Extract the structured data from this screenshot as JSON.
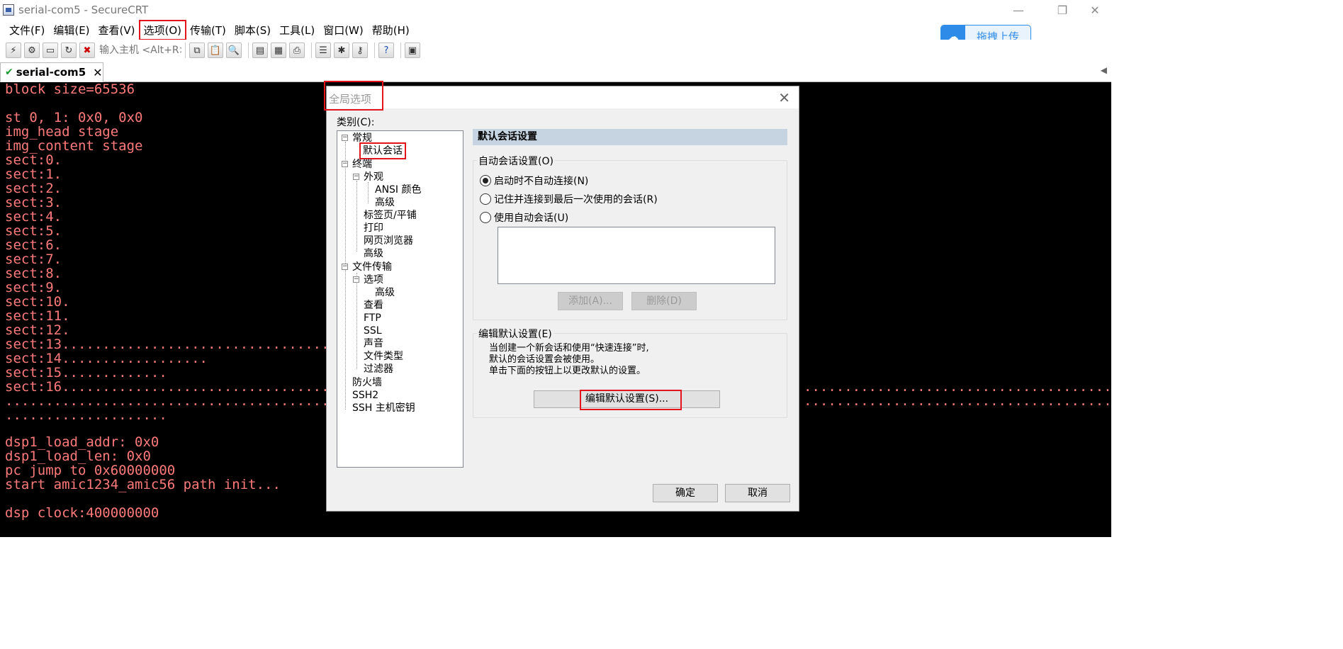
{
  "window": {
    "title": "serial-com5 - SecureCRT",
    "minimize": "—",
    "restore": "❐",
    "close": "✕"
  },
  "menu": [
    "文件(F)",
    "编辑(E)",
    "查看(V)",
    "选项(O)",
    "传输(T)",
    "脚本(S)",
    "工具(L)",
    "窗口(W)",
    "帮助(H)"
  ],
  "upload": {
    "label": "拖拽上传"
  },
  "toolbar": {
    "host_placeholder": "输入主机 <Alt+R>"
  },
  "tab": {
    "label": "serial-com5",
    "close": "✕"
  },
  "terminal": {
    "lines": [
      "block size=65536",
      "",
      "st 0, 1: 0x0, 0x0",
      "img_head stage",
      "img_content stage",
      "sect:0.",
      "sect:1.",
      "sect:2.",
      "sect:3.",
      "sect:4.",
      "sect:5.",
      "sect:6.",
      "sect:7.",
      "sect:8.",
      "sect:9.",
      "sect:10.",
      "sect:11.",
      "sect:12.",
      "sect:13..................................................",
      "sect:14..................",
      "sect:15.............",
      "sect:16..................................................",
      "........................................................",
      "....................",
      "",
      "dsp1_load_addr: 0x0",
      "dsp1_load_len: 0x0",
      "pc jump to 0x60000000",
      "start amic1234_amic56 path init...",
      "",
      "dsp clock:400000000"
    ],
    "right_dots": "..........................................................."
  },
  "dialog": {
    "title": "全局选项",
    "close": "✕",
    "category_label": "类别(C):",
    "tree": {
      "general": "常规",
      "default_session": "默认会话",
      "terminal": "终端",
      "appearance": "外观",
      "ansi_color": "ANSI 颜色",
      "appearance_advanced": "高级",
      "tabs_tiles": "标签页/平铺",
      "print": "打印",
      "web_browser": "网页浏览器",
      "terminal_advanced": "高级",
      "file_transfer": "文件传输",
      "options": "选项",
      "options_advanced": "高级",
      "view": "查看",
      "ftp": "FTP",
      "ssl": "SSL",
      "sound": "声音",
      "file_types": "文件类型",
      "filters": "过滤器",
      "firewall": "防火墙",
      "ssh2": "SSH2",
      "ssh_host_keys": "SSH 主机密钥"
    },
    "panel_title": "默认会话设置",
    "auto_group": {
      "title": "自动会话设置(O)",
      "radio1": "启动时不自动连接(N)",
      "radio2": "记住并连接到最后一次使用的会话(R)",
      "radio3": "使用自动会话(U)",
      "selected": 1,
      "add": "添加(A)...",
      "delete": "删除(D)"
    },
    "edit_group": {
      "title": "编辑默认设置(E)",
      "desc1": "当创建一个新会话和使用“快速连接”时,",
      "desc2": "默认的会话设置会被使用。",
      "desc3": "单击下面的按钮上以更改默认的设置。",
      "button": "编辑默认设置(S)..."
    },
    "ok": "确定",
    "cancel": "取消"
  }
}
